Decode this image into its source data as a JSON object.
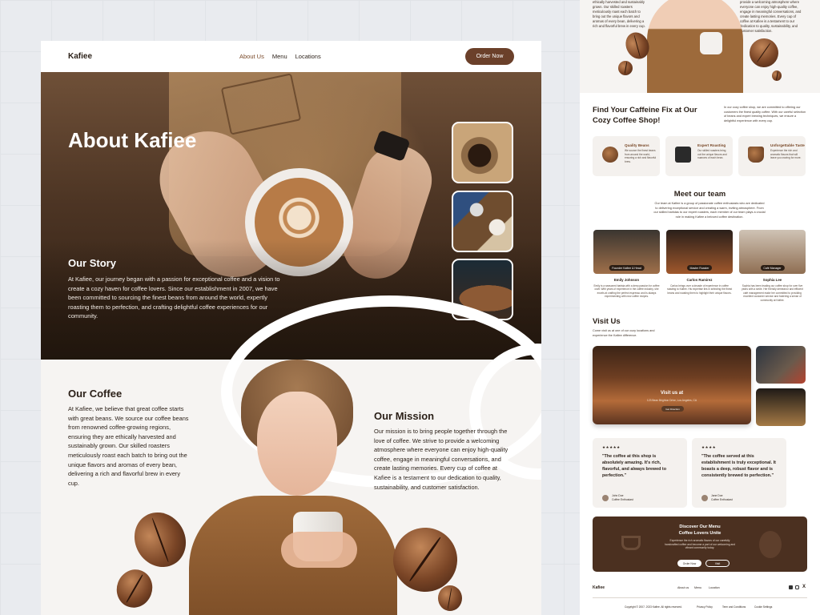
{
  "main": {
    "logo": "Kafiee",
    "nav": [
      "About Us",
      "Menu",
      "Locations"
    ],
    "order_button": "Order Now",
    "hero_title": "About Kafiee",
    "story_title": "Our Story",
    "story_text": "At Kafiee, our journey began with a passion for exceptional coffee and a vision to create a cozy haven for coffee lovers. Since our establishment in 2007, we have been committed to sourcing the finest beans from around the world, expertly roasting them to perfection, and crafting delightful coffee experiences for our community.",
    "coffee_title": "Our Coffee",
    "coffee_text": "At Kafiee, we believe that great coffee starts with great beans. We source our coffee beans from renowned coffee-growing regions, ensuring they are ethically harvested and sustainably grown. Our skilled roasters meticulously roast each batch to bring out the unique flavors and aromas of every bean, delivering a rich and flavorful brew in every cup.",
    "mission_title": "Our Mission",
    "mission_text": "Our mission is to bring people together through the love of coffee. We strive to provide a welcoming atmosphere where everyone can enjoy high-quality coffee, engage in meaningful conversations, and create lasting memories. Every cup of coffee at Kafiee is a testament to our dedication to quality, sustainability, and customer satisfaction."
  },
  "preview": {
    "top_left_text": "ethically harvested and sustainably grown. Our skilled roasters meticulously roast each batch to bring out the unique flavors and aromas of every bean, delivering a rich and flavorful brew in every cup.",
    "top_right_text": "provide a welcoming atmosphere where everyone can enjoy high-quality coffee, engage in meaningful conversations, and create lasting memories. Every cup of coffee at Kafiee is a testament to our dedication to quality, sustainability, and customer satisfaction.",
    "caffeine_title": "Find Your Caffeine Fix at Our Cozy Coffee Shop!",
    "caffeine_text": "In our cozy coffee shop, we are committed to offering our customers the finest quality coffee. With our careful selection of beans and expert brewing techniques, we ensure a delightful experience with every cup.",
    "features": [
      {
        "title": "Quality Beans",
        "desc": "We source the finest beans from around the world, ensuring a rich and flavorful brew."
      },
      {
        "title": "Expert Roasting",
        "desc": "Our skilled roasters bring out the unique flavors and nuances of each bean."
      },
      {
        "title": "Unforgettable Taste",
        "desc": "Experience the rich and aromatic flavors that will leave you craving for more."
      }
    ],
    "team_title": "Meet our team",
    "team_text": "Our team at Kafiee is a group of passionate coffee enthusiasts who are dedicated to delivering exceptional service and creating a warm, inviting atmosphere. From our skilled baristas to our expert roasters, each member of our team plays a crucial role in making Kafiee a beloved coffee destination.",
    "team": [
      {
        "role": "Founder Kafiee & Head",
        "name": "Emily Johnson",
        "desc": "Emily is a seasoned barista with a deep passion for coffee craft. With years of experience in the coffee industry, she excels at crafting the perfect espresso and is always experimenting with new coffee recipes."
      },
      {
        "role": "Master Roaster",
        "name": "Carlos Ramirez",
        "desc": "Carlos brings over a decade of experience in coffee roasting to Kafiee. His expertise lies in selecting the finest beans and roasting them to highlight their unique flavors."
      },
      {
        "role": "Café Manager",
        "name": "Sophia Lee",
        "desc": "Sophia has been leading our coffee shop for over five years with a smile. Her friendly demeanor and efficient café management make her committed to providing excellent customer service and fostering a sense of community at Kafiee."
      }
    ],
    "visit_title": "Visit Us",
    "visit_text": "Come visit us at one of our cozy locations and experience the Kafiee difference.",
    "visit_overlay_title": "Visit us at",
    "visit_overlay_address": "123 Bean Brighton Drive, Los Angeles, CA",
    "visit_button": "Get Direction",
    "reviews": [
      {
        "stars": "★★★★★",
        "quote": "\"The coffee at this shop is absolutely amazing. It's rich, flavorful, and always brewed to perfection.\"",
        "name": "John Doe",
        "role": "Coffee Enthusiast"
      },
      {
        "stars": "★★★★",
        "quote": "\"The coffee served at this establishment is truly exceptional. It boasts a deep, robust flavor and is consistently brewed to perfection.\"",
        "name": "Jane Doe",
        "role": "Coffee Enthusiast"
      }
    ],
    "cta_title_1": "Discover Our Menu",
    "cta_title_2": "Coffee Lovers Unite",
    "cta_text": "Experience the rich aromatic flavors of our carefully handcrafted coffee and become a part of our welcoming and vibrant community today.",
    "cta_btn_order": "Order Now",
    "cta_btn_visit": "Visit",
    "footer_logo": "Kafiee",
    "footer_links": [
      "About us",
      "Menu",
      "Location"
    ],
    "copyright": "Copyright © 2007- 2023 Kafiee. All rights reserved.",
    "legal_links": [
      "Privacy Policy",
      "Term and Conditions",
      "Cookie Settings"
    ]
  }
}
